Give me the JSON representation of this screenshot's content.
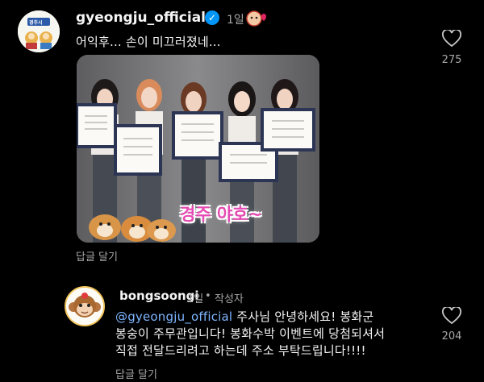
{
  "comment1": {
    "username": "gyeongju_official",
    "time": "1일",
    "text": "어익후... 손이 미끄러졌네...",
    "like_count": "275",
    "reply_label": "답글 달기",
    "avatar_text": "경주시",
    "image_caption": "경주 야호~"
  },
  "comment2": {
    "username": "bongsoongi",
    "time": "1일",
    "author_badge": "작성자",
    "mention": "@gyeongju_official",
    "line1": " 주사님 안녕하세요! 봉화군",
    "line2": "봉숭이 주무관입니다! 봉화수박 이벤트에 당첨되셔서",
    "line3": "직접 전달드리려고 하는데 주소 부탁드립니다!!!!",
    "like_count": "204",
    "reply_label": "답글 달기"
  },
  "colors": {
    "background": "#000000",
    "secondary_text": "#a8a8a8",
    "mention": "#7db5ff",
    "verified": "#0095f6",
    "caption": "#e64bb3"
  },
  "icons": [
    "verified-badge-icon",
    "heart-icon",
    "reaction-icon"
  ]
}
